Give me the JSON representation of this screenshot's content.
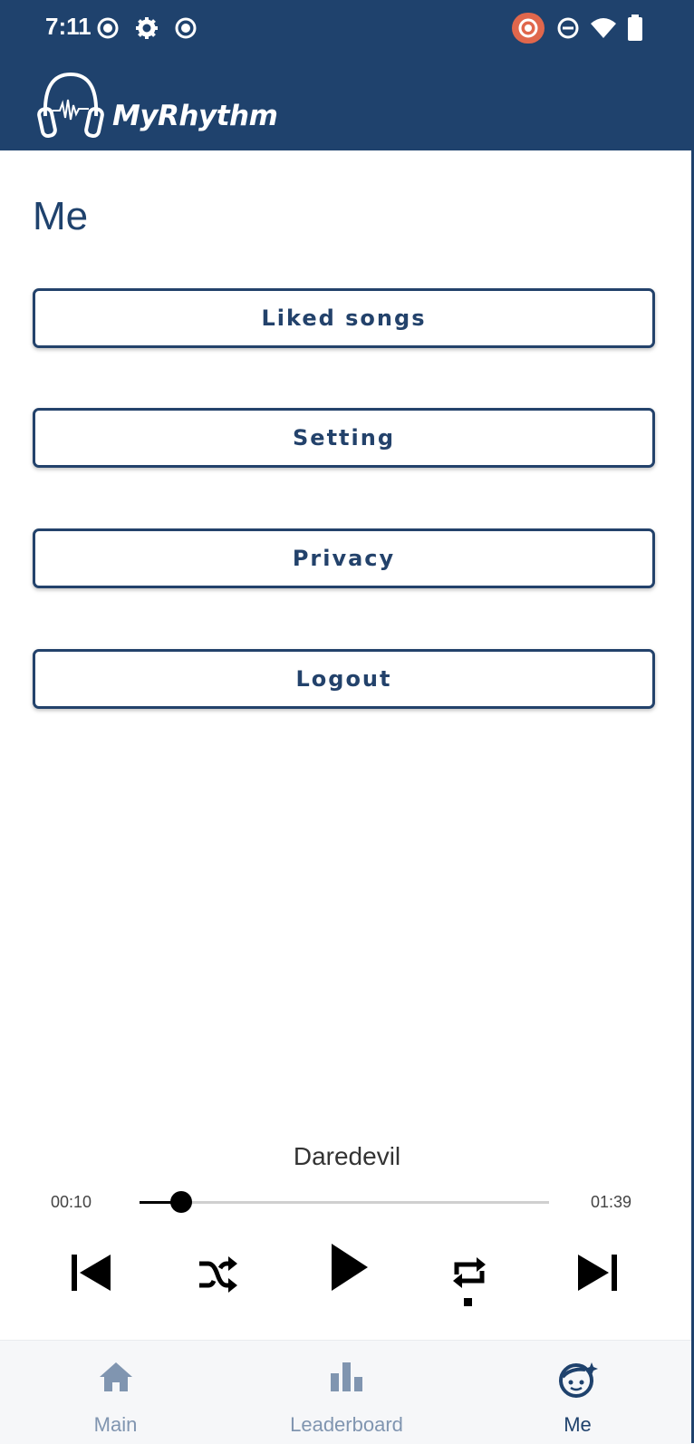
{
  "status_bar": {
    "time": "7:11",
    "icons": [
      "record-icon",
      "gear-icon",
      "record-icon",
      "cast-record-icon",
      "do-not-disturb-icon",
      "wifi-icon",
      "battery-icon"
    ]
  },
  "app": {
    "logo_text": "MyRhythm",
    "brand_color": "#1f426d"
  },
  "page": {
    "title": "Me"
  },
  "menu": [
    {
      "label": "Liked songs"
    },
    {
      "label": "Setting"
    },
    {
      "label": "Privacy"
    },
    {
      "label": "Logout"
    }
  ],
  "player": {
    "track_title": "Daredevil",
    "elapsed": "00:10",
    "duration": "01:39",
    "progress_fraction": 0.101
  },
  "bottom_nav": [
    {
      "label": "Main",
      "icon": "home-icon",
      "active": false
    },
    {
      "label": "Leaderboard",
      "icon": "bar-chart-icon",
      "active": false
    },
    {
      "label": "Me",
      "icon": "face-icon",
      "active": true
    }
  ]
}
